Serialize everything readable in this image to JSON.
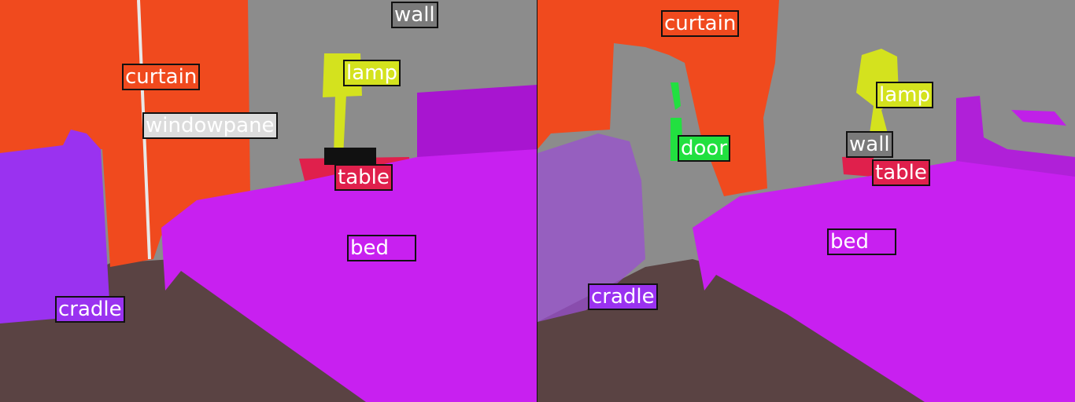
{
  "colors": {
    "wall": "#8c8c8c",
    "floor": "#5a4343",
    "curtain": "#f04a1e",
    "cradle": "#9a32f0",
    "bed": "#c820f0",
    "lamp": "#d4e21e",
    "table": "#e0204c",
    "windowpane": "#dcdcdc",
    "door": "#22e040",
    "label_wall": "#7a7a7a"
  },
  "left_panel": {
    "labels": [
      {
        "text": "wall",
        "cls": "label_wall"
      },
      {
        "text": "curtain",
        "cls": "curtain"
      },
      {
        "text": "lamp",
        "cls": "lamp"
      },
      {
        "text": "windowpane",
        "cls": "windowpane"
      },
      {
        "text": "table",
        "cls": "table"
      },
      {
        "text": "bed",
        "cls": "bed"
      },
      {
        "text": "cradle",
        "cls": "cradle"
      }
    ]
  },
  "right_panel": {
    "labels": [
      {
        "text": "curtain",
        "cls": "curtain"
      },
      {
        "text": "lamp",
        "cls": "lamp"
      },
      {
        "text": "door",
        "cls": "door"
      },
      {
        "text": "wall",
        "cls": "label_wall"
      },
      {
        "text": "table",
        "cls": "table"
      },
      {
        "text": "bed",
        "cls": "bed"
      },
      {
        "text": "cradle",
        "cls": "cradle"
      }
    ]
  }
}
